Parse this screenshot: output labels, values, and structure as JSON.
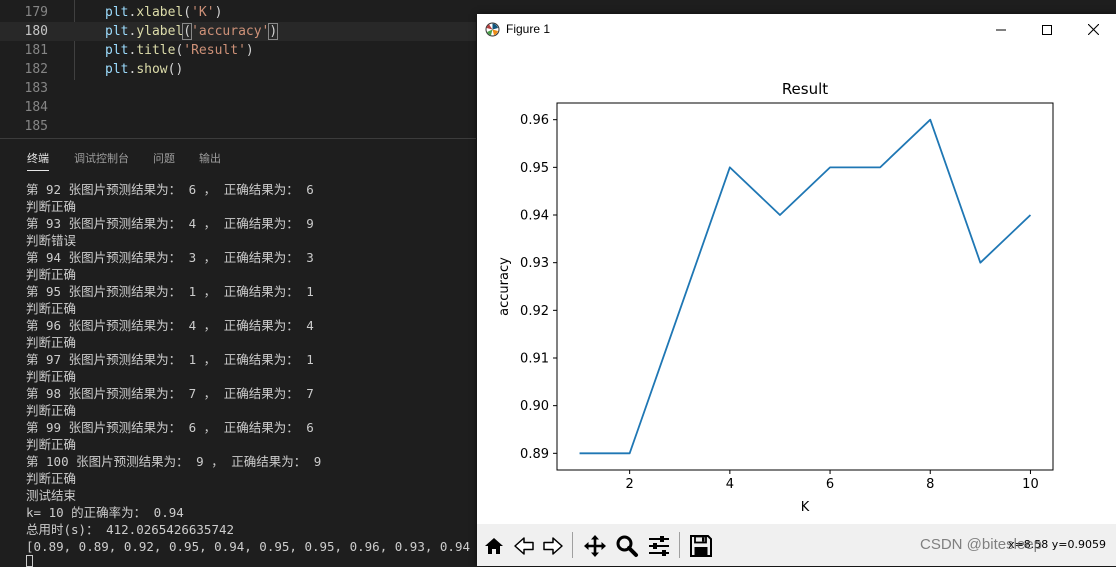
{
  "editor": {
    "lines": [
      {
        "num": "179",
        "tokens": [
          [
            "obj",
            "plt"
          ],
          [
            "pun",
            "."
          ],
          [
            "fn",
            "xlabel"
          ],
          [
            "pun",
            "("
          ],
          [
            "str",
            "'K'"
          ],
          [
            "pun",
            ")"
          ]
        ]
      },
      {
        "num": "180",
        "tokens": [
          [
            "obj",
            "plt"
          ],
          [
            "pun",
            "."
          ],
          [
            "fn",
            "ylabel"
          ],
          [
            "pun",
            "("
          ],
          [
            "str",
            "'accuracy'"
          ],
          [
            "pun",
            ")"
          ]
        ]
      },
      {
        "num": "181",
        "tokens": [
          [
            "obj",
            "plt"
          ],
          [
            "pun",
            "."
          ],
          [
            "fn",
            "title"
          ],
          [
            "pun",
            "("
          ],
          [
            "str",
            "'Result'"
          ],
          [
            "pun",
            ")"
          ]
        ]
      },
      {
        "num": "182",
        "tokens": [
          [
            "obj",
            "plt"
          ],
          [
            "pun",
            "."
          ],
          [
            "fn",
            "show"
          ],
          [
            "pun",
            "()"
          ]
        ]
      },
      {
        "num": "183",
        "tokens": []
      },
      {
        "num": "184",
        "tokens": []
      },
      {
        "num": "185",
        "tokens": []
      }
    ],
    "active_line": "180"
  },
  "panel": {
    "tabs": [
      "终端",
      "调试控制台",
      "问题",
      "输出"
    ],
    "active_tab": "终端",
    "terminal_lines": [
      "第 92 张图片预测结果为： 6 ， 正确结果为： 6",
      "判断正确",
      "第 93 张图片预测结果为： 4 ， 正确结果为： 9",
      "判断错误",
      "第 94 张图片预测结果为： 3 ， 正确结果为： 3",
      "判断正确",
      "第 95 张图片预测结果为： 1 ， 正确结果为： 1",
      "判断正确",
      "第 96 张图片预测结果为： 4 ， 正确结果为： 4",
      "判断正确",
      "第 97 张图片预测结果为： 1 ， 正确结果为： 1",
      "判断正确",
      "第 98 张图片预测结果为： 7 ， 正确结果为： 7",
      "判断正确",
      "第 99 张图片预测结果为： 6 ， 正确结果为： 6",
      "判断正确",
      "第 100 张图片预测结果为： 9 ， 正确结果为： 9",
      "判断正确",
      "测试结束",
      "k= 10 的正确率为： 0.94",
      "总用时(s)： 412.0265426635742",
      "[0.89, 0.89, 0.92, 0.95, 0.94, 0.95, 0.95, 0.96, 0.93, 0.94]"
    ]
  },
  "figure": {
    "window_title": "Figure 1",
    "coords_text": "x=8.58  y=0.9059",
    "watermark": "CSDN @bitesleep"
  },
  "colors": {
    "line": "#1f77b4",
    "editor_bg": "#1e1e1e",
    "toolbar_bg": "#f0f0f0"
  },
  "chart_data": {
    "type": "line",
    "title": "Result",
    "xlabel": "K",
    "ylabel": "accuracy",
    "x": [
      1,
      2,
      3,
      4,
      5,
      6,
      7,
      8,
      9,
      10
    ],
    "series": [
      {
        "values": [
          0.89,
          0.89,
          0.92,
          0.95,
          0.94,
          0.95,
          0.95,
          0.96,
          0.93,
          0.94
        ]
      }
    ],
    "xticks": [
      2,
      4,
      6,
      8,
      10
    ],
    "yticks": [
      0.89,
      0.9,
      0.91,
      0.92,
      0.93,
      0.94,
      0.95,
      0.96
    ],
    "xlim": [
      0.55,
      10.45
    ],
    "ylim": [
      0.8865,
      0.9635
    ],
    "grid": false
  }
}
